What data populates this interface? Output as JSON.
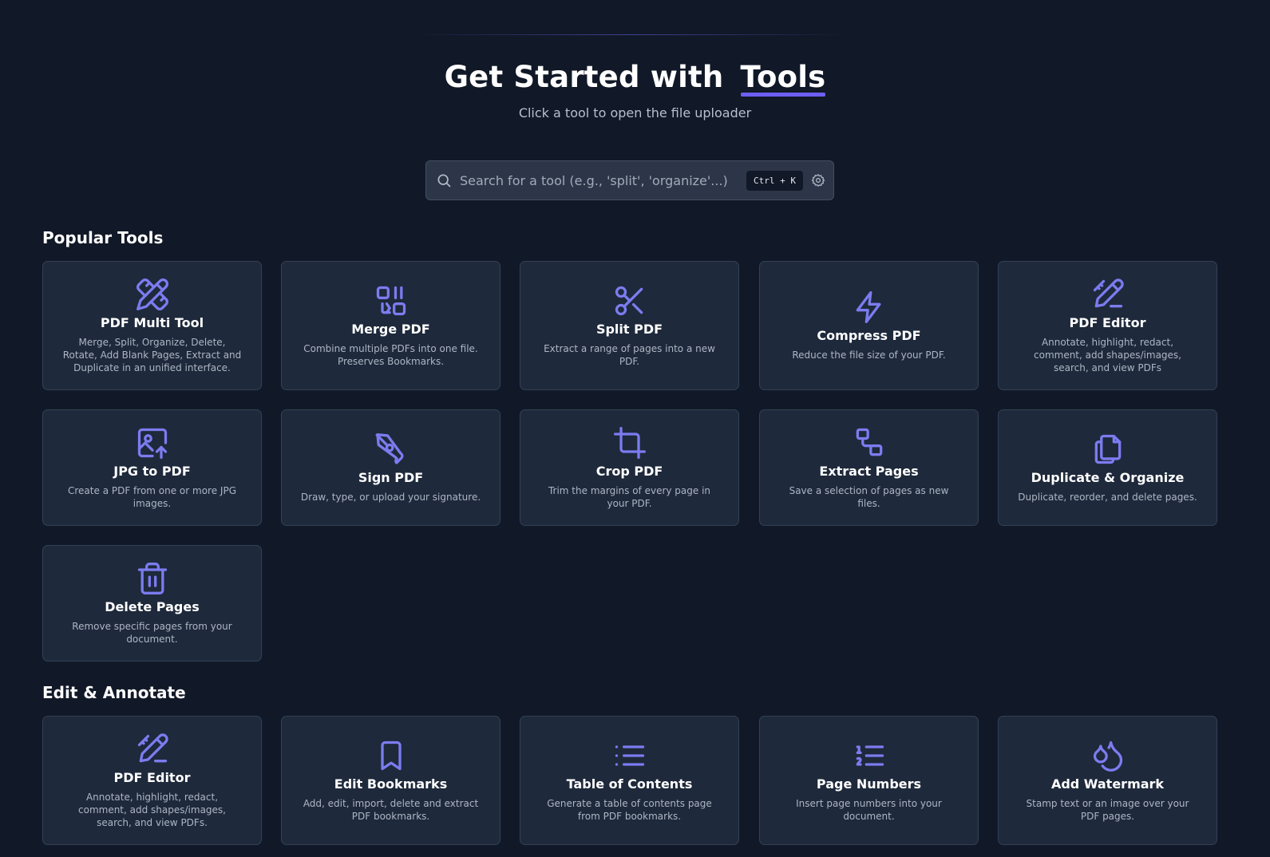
{
  "hero": {
    "title_prefix": "Get Started with",
    "title_accent": "Tools",
    "subtitle": "Click a tool to open the file uploader"
  },
  "search": {
    "placeholder": "Search for a tool (e.g., 'split', 'organize'...)",
    "shortcut": "Ctrl + K"
  },
  "colors": {
    "background": "#111827",
    "card": "#1e293b",
    "accent": "#6d5ff6",
    "icon": "#7c7cf0"
  },
  "sections": {
    "popular": {
      "title": "Popular Tools",
      "tools": [
        {
          "name": "PDF Multi Tool",
          "desc": "Merge, Split, Organize, Delete, Rotate, Add Blank Pages, Extract and Duplicate in an unified interface.",
          "icon": "pencil-ruler-icon"
        },
        {
          "name": "Merge PDF",
          "desc": "Combine multiple PDFs into one file. Preserves Bookmarks.",
          "icon": "merge-icon"
        },
        {
          "name": "Split PDF",
          "desc": "Extract a range of pages into a new PDF.",
          "icon": "scissors-icon"
        },
        {
          "name": "Compress PDF",
          "desc": "Reduce the file size of your PDF.",
          "icon": "lightning-icon"
        },
        {
          "name": "PDF Editor",
          "desc": "Annotate, highlight, redact, comment, add shapes/images, search, and view PDFs",
          "icon": "pen-ruler-icon"
        },
        {
          "name": "JPG to PDF",
          "desc": "Create a PDF from one or more JPG images.",
          "icon": "image-upload-icon"
        },
        {
          "name": "Sign PDF",
          "desc": "Draw, type, or upload your signature.",
          "icon": "pen-nib-icon"
        },
        {
          "name": "Crop PDF",
          "desc": "Trim the margins of every page in your PDF.",
          "icon": "crop-icon"
        },
        {
          "name": "Extract Pages",
          "desc": "Save a selection of pages as new files.",
          "icon": "extract-icon"
        },
        {
          "name": "Duplicate & Organize",
          "desc": "Duplicate, reorder, and delete pages.",
          "icon": "copy-icon"
        },
        {
          "name": "Delete Pages",
          "desc": "Remove specific pages from your document.",
          "icon": "trash-icon"
        }
      ]
    },
    "edit": {
      "title": "Edit & Annotate",
      "tools": [
        {
          "name": "PDF Editor",
          "desc": "Annotate, highlight, redact, comment, add shapes/images, search, and view PDFs.",
          "icon": "pen-ruler-icon"
        },
        {
          "name": "Edit Bookmarks",
          "desc": "Add, edit, import, delete and extract PDF bookmarks.",
          "icon": "bookmark-icon"
        },
        {
          "name": "Table of Contents",
          "desc": "Generate a table of contents page from PDF bookmarks.",
          "icon": "list-icon"
        },
        {
          "name": "Page Numbers",
          "desc": "Insert page numbers into your document.",
          "icon": "numbered-list-icon"
        },
        {
          "name": "Add Watermark",
          "desc": "Stamp text or an image over your PDF pages.",
          "icon": "droplets-icon"
        }
      ]
    }
  }
}
